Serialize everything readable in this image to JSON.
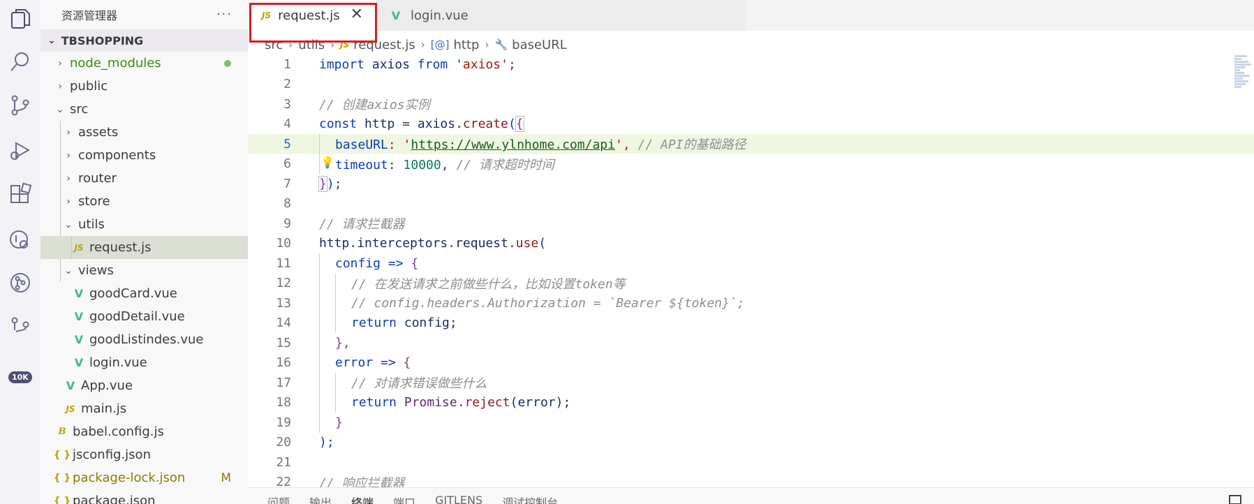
{
  "activity_bar": {
    "icons": [
      "explorer-icon",
      "search-icon",
      "source-control-icon",
      "run-debug-icon",
      "extensions-icon",
      "remote-explorer-icon",
      "git-graph-icon",
      "gitlens-icon"
    ],
    "badge": "10K"
  },
  "sidebar": {
    "title": "资源管理器",
    "more": "···",
    "project": "TBSHOPPING",
    "items": [
      {
        "label": "node_modules",
        "status": ""
      },
      {
        "label": "public"
      },
      {
        "label": "src"
      },
      {
        "label": "assets"
      },
      {
        "label": "components"
      },
      {
        "label": "router"
      },
      {
        "label": "store"
      },
      {
        "label": "utils"
      },
      {
        "label": "request.js"
      },
      {
        "label": "views"
      },
      {
        "label": "goodCard.vue"
      },
      {
        "label": "goodDetail.vue"
      },
      {
        "label": "goodListindes.vue"
      },
      {
        "label": "login.vue"
      },
      {
        "label": "App.vue"
      },
      {
        "label": "main.js"
      },
      {
        "label": "babel.config.js"
      },
      {
        "label": "jsconfig.json"
      },
      {
        "label": "package-lock.json",
        "status": "M"
      },
      {
        "label": "package.json"
      }
    ],
    "icon_js": "JS",
    "icon_vue": "V",
    "icon_babel": "B",
    "icon_json": "{ }"
  },
  "tabs": [
    {
      "label": "request.js",
      "icon": "JS",
      "close": "✕"
    },
    {
      "label": "login.vue",
      "icon": "V"
    }
  ],
  "breadcrumb": {
    "parts": [
      "src",
      "utils",
      "request.js",
      "http",
      "baseURL"
    ],
    "sep": "›",
    "js_icon": "JS",
    "sym_icon": "[@]",
    "wrench": "🔧"
  },
  "code": {
    "line_numbers": [
      "1",
      "2",
      "3",
      "4",
      "5",
      "6",
      "7",
      "8",
      "9",
      "10",
      "11",
      "12",
      "13",
      "14",
      "15",
      "16",
      "17",
      "18",
      "19",
      "20",
      "21",
      "22"
    ],
    "l1": [
      "import",
      " axios ",
      "from",
      " ",
      "'axios'",
      ";"
    ],
    "l3": "// 创建axios实例",
    "l4": [
      "const",
      " http ",
      "=",
      " axios.",
      "create",
      "(",
      "{"
    ],
    "l5": [
      "baseURL",
      ": '",
      "https://www.ylnhome.com/api",
      "', ",
      "// API的基础路径"
    ],
    "l6": [
      "timeout",
      ": ",
      "10000",
      ", ",
      "// 请求超时时间"
    ],
    "l7": [
      "}",
      ")",
      ";"
    ],
    "l9": "// 请求拦截器",
    "l10": [
      "http",
      ".",
      "interceptors",
      ".",
      "request",
      ".",
      "use",
      "("
    ],
    "l11": [
      "config",
      " => ",
      "{"
    ],
    "l12": "// 在发送请求之前做些什么，比如设置token等",
    "l13": "// config.headers.Authorization = `Bearer ${token}`;",
    "l14": [
      "return",
      " config;"
    ],
    "l15": "},",
    "l16": [
      "error",
      " => ",
      "{"
    ],
    "l17": "// 对请求错误做些什么",
    "l18": [
      "return",
      " ",
      "Promise",
      ".",
      "reject",
      "(error);"
    ],
    "l19": "}",
    "l20": ");",
    "l22": "// 响应拦截器",
    "bulb": "💡"
  },
  "panel": {
    "tabs": [
      "问题",
      "输出",
      "终端",
      "端口",
      "GITLENS",
      "调试控制台"
    ]
  }
}
